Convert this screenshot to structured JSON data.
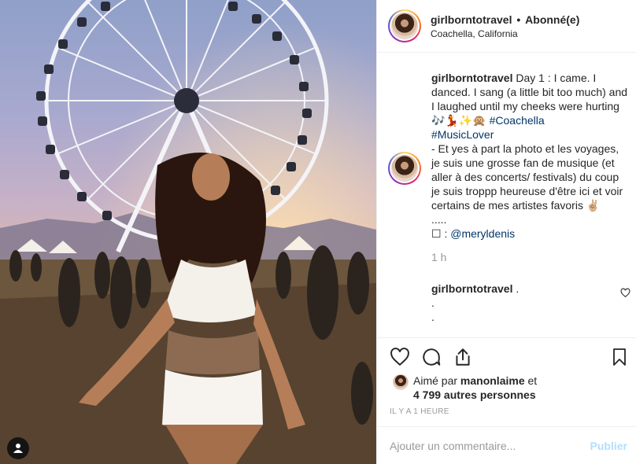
{
  "post": {
    "username": "girlborntotravel",
    "follow_status": "Abonné(e)",
    "location": "Coachella, California"
  },
  "caption": {
    "username": "girlborntotravel",
    "text_1": "Day 1 : I came. I danced. I sang (a little bit too much) and I laughed until my cheeks were hurting 🎶💃✨🙊",
    "hashtag_1": "#Coachella",
    "hashtag_2": "#MusicLover",
    "text_2": "- Et yes à part la photo et les voyages, je suis une grosse fan de musique (et aller à des concerts/ festivals) du coup je suis troppp heureuse d'être ici et voir certains de mes artistes favoris ✌🏼",
    "ellipsis": ".....",
    "credit_icon": "☐ :",
    "credit_mention": "@meryldenis",
    "time": "1 h"
  },
  "comment": {
    "username": "girlborntotravel",
    "line_1": ".",
    "line_2": ".",
    "line_3": "."
  },
  "likes": {
    "prefix": "Aimé par",
    "liker": "manonlaime",
    "joiner": "et",
    "others": "4 799 autres personnes"
  },
  "timestamp": "IL Y A 1 HEURE",
  "add_comment": {
    "placeholder": "Ajouter un commentaire...",
    "publish_label": "Publier",
    "publish_color": "#b2dffc"
  },
  "icons": [
    "heart-icon",
    "comment-icon",
    "share-icon",
    "bookmark-icon",
    "user-tag-icon"
  ]
}
